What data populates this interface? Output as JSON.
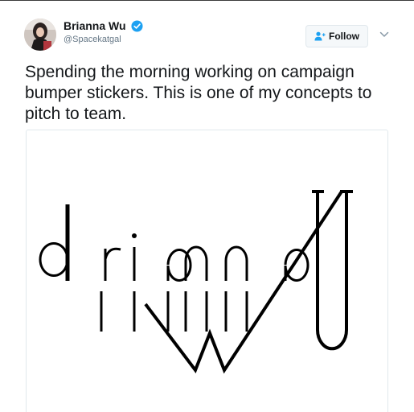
{
  "tweet": {
    "display_name": "Brianna Wu",
    "handle": "@Spacekatgal",
    "text": "Spending the morning working on campaign bumper stickers. This is one of my concepts to pitch to team.",
    "follow_label": "Follow",
    "icons": {
      "verified": "verified-badge-icon",
      "follow": "add-user-icon",
      "more": "chevron-down-icon"
    }
  },
  "media": {
    "logo_text": "briannaWu"
  },
  "colors": {
    "text": "#14171a",
    "secondary": "#657786",
    "verified": "#1da1f2",
    "border": "#e1e8ed"
  }
}
